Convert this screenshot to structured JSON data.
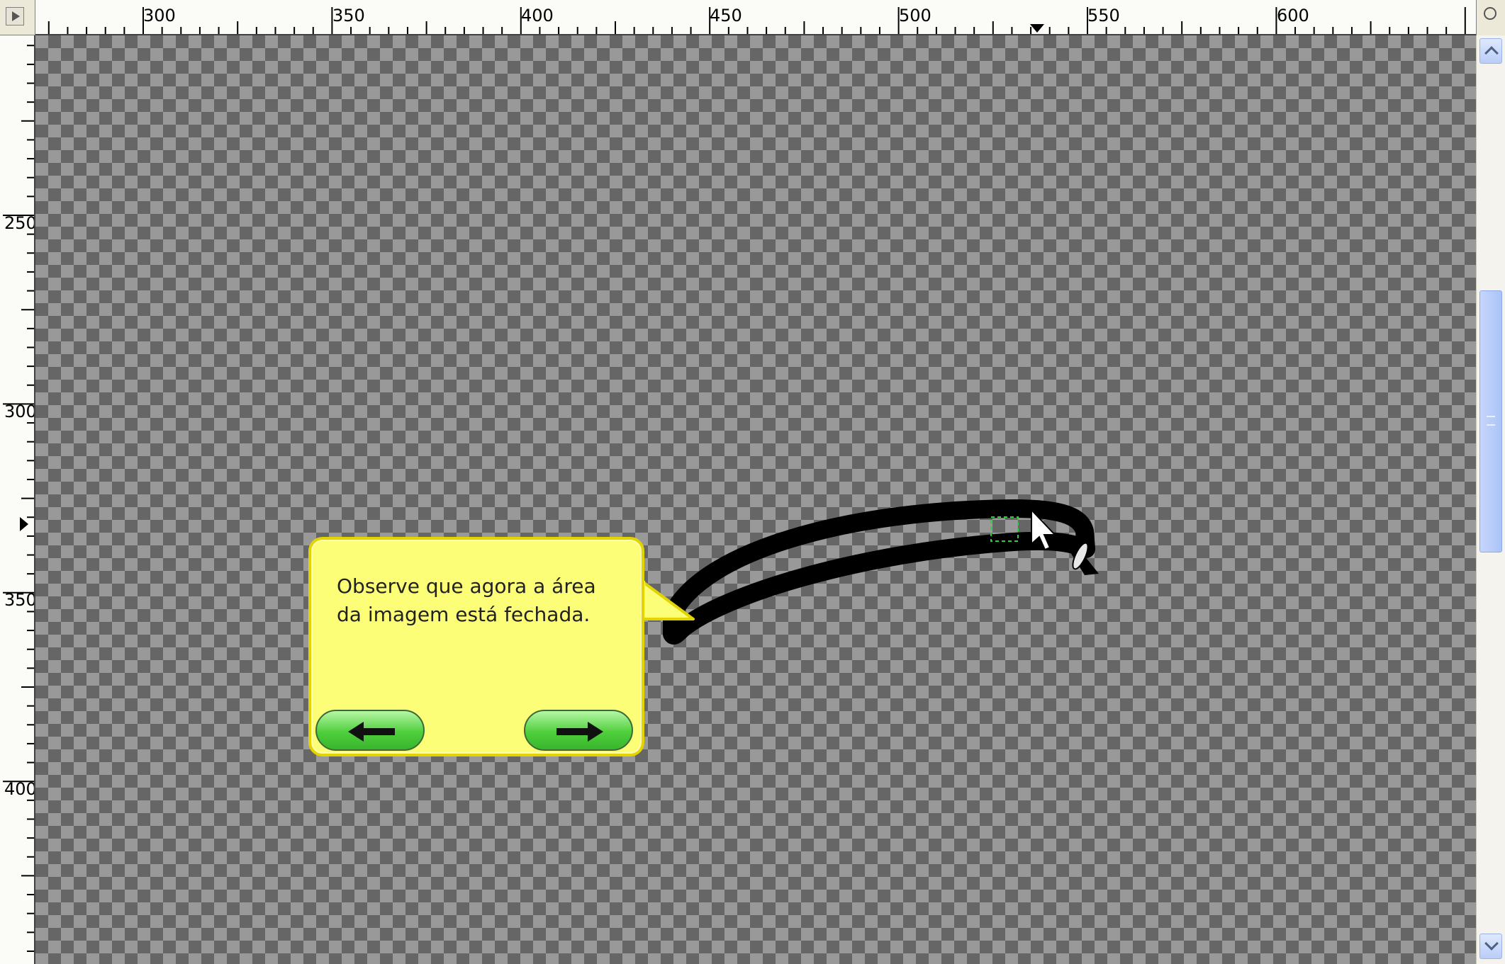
{
  "ruler": {
    "horizontal_labels": [
      "300",
      "350",
      "400",
      "450",
      "500",
      "550",
      "600"
    ],
    "vertical_labels": [
      "250",
      "300",
      "350",
      "400"
    ]
  },
  "callout": {
    "text_line1": "Observe que agora a área",
    "text_line2": "da imagem está fechada.",
    "prev_icon": "arrow-left-icon",
    "next_icon": "arrow-right-icon"
  },
  "colors": {
    "callout_fill": "#fdfe78",
    "callout_border": "#e2d400",
    "button_green": "#4fcf3c",
    "stroke": "#000000"
  }
}
